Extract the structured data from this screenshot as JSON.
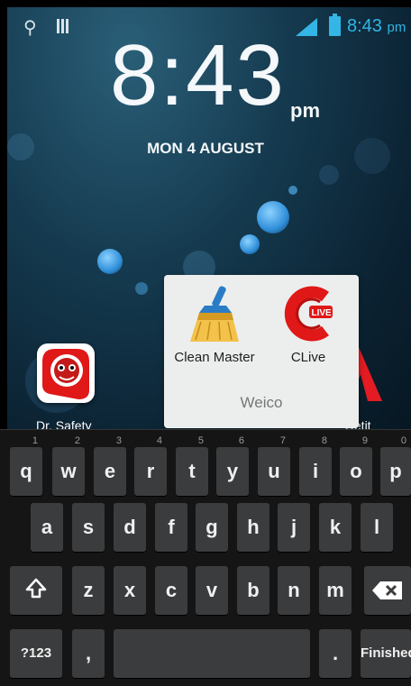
{
  "status_bar": {
    "time": "8:43",
    "ampm": "pm"
  },
  "lockscreen": {
    "clock": "8:43",
    "ampm": "pm",
    "date": "MON 4 AUGUST"
  },
  "desktop": {
    "apps": [
      {
        "label": "Dr. Safety"
      },
      {
        "label": "Getit"
      }
    ]
  },
  "folder": {
    "name": "Weico",
    "apps": [
      {
        "label": "Clean Master",
        "icon": "broom-icon"
      },
      {
        "label": "CLive",
        "icon": "clive-icon"
      }
    ]
  },
  "keyboard": {
    "row1": [
      {
        "label": "q",
        "hint": "1"
      },
      {
        "label": "w",
        "hint": "2"
      },
      {
        "label": "e",
        "hint": "3"
      },
      {
        "label": "r",
        "hint": "4"
      },
      {
        "label": "t",
        "hint": "5"
      },
      {
        "label": "y",
        "hint": "6"
      },
      {
        "label": "u",
        "hint": "7"
      },
      {
        "label": "i",
        "hint": "8"
      },
      {
        "label": "o",
        "hint": "9"
      },
      {
        "label": "p",
        "hint": "0"
      }
    ],
    "row2": [
      "a",
      "s",
      "d",
      "f",
      "g",
      "h",
      "j",
      "k",
      "l"
    ],
    "row3": [
      "z",
      "x",
      "c",
      "v",
      "b",
      "n",
      "m"
    ],
    "symbols_key": "?123",
    "comma_key": ",",
    "period_key": ".",
    "action_key": "Finished"
  },
  "colors": {
    "accent": "#33b5e5",
    "key_bg": "#3b3c3d",
    "folder_bg": "#eceeed"
  }
}
